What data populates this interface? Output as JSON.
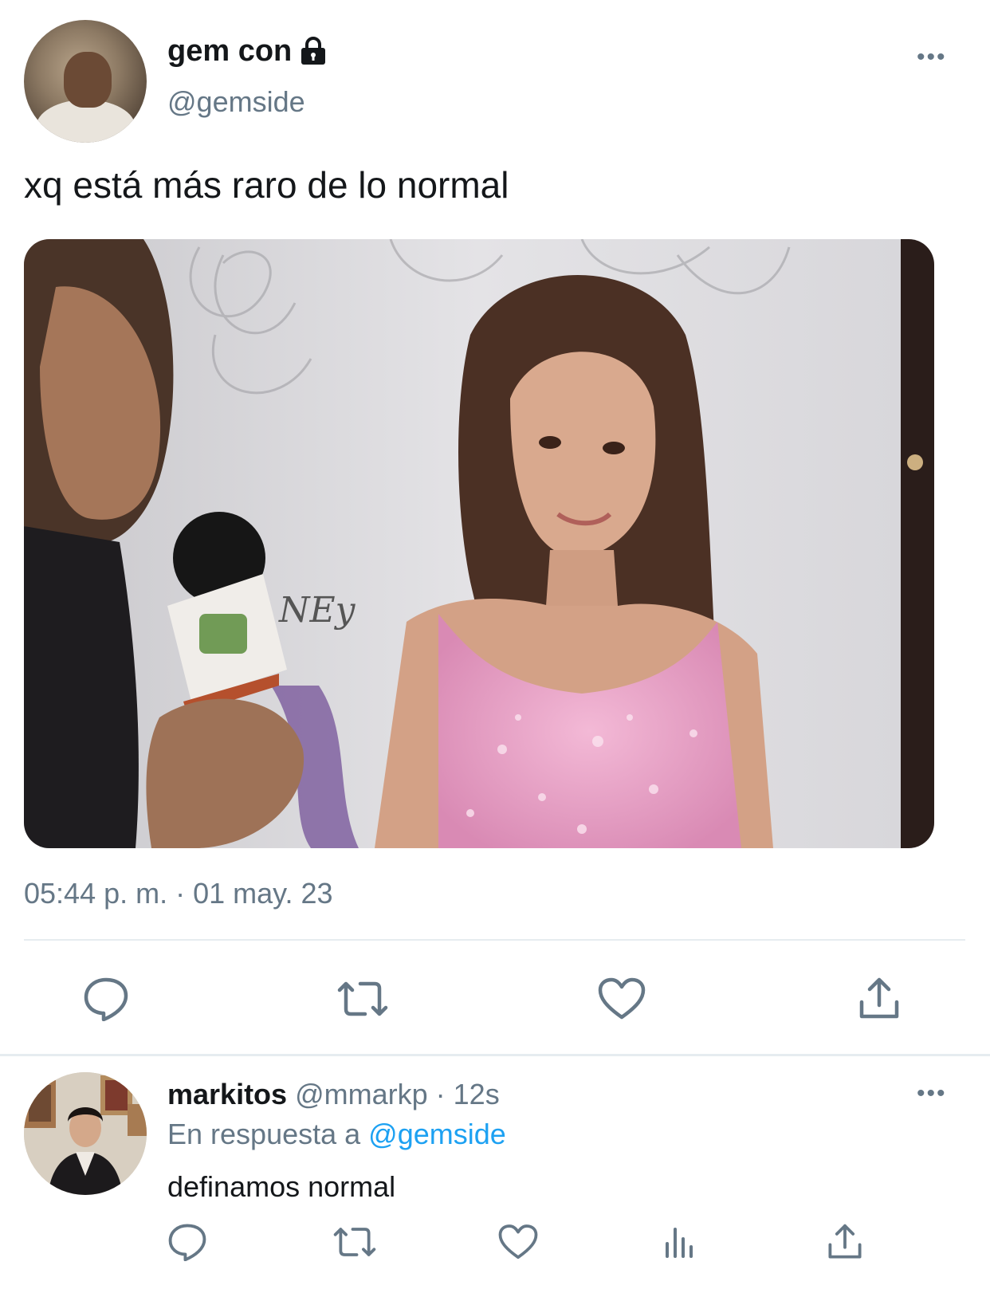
{
  "tweet": {
    "display_name": "gem con",
    "handle": "@gemside",
    "text": "xq está más raro de lo normal",
    "timestamp": "05:44 p. m. · 01 may. 23",
    "more_label": "•••",
    "media_alt": "Video frame: interviewer holding microphone with logo, girl with long brown hair in pink sequin top"
  },
  "reply": {
    "display_name": "markitos",
    "handle": "@mmarkp",
    "time": "· 12s",
    "in_reply_prefix": "En respuesta a",
    "in_reply_mention": "@gemside",
    "text": "definamos normal",
    "more_label": "•••"
  },
  "icons": {
    "lock": "lock-icon",
    "reply": "reply-icon",
    "retweet": "retweet-icon",
    "like": "heart-icon",
    "share": "share-icon",
    "analytics": "analytics-icon"
  },
  "colors": {
    "text": "#14171a",
    "secondary": "#657786",
    "link": "#1da1f2",
    "divider": "#e6ecf0"
  }
}
